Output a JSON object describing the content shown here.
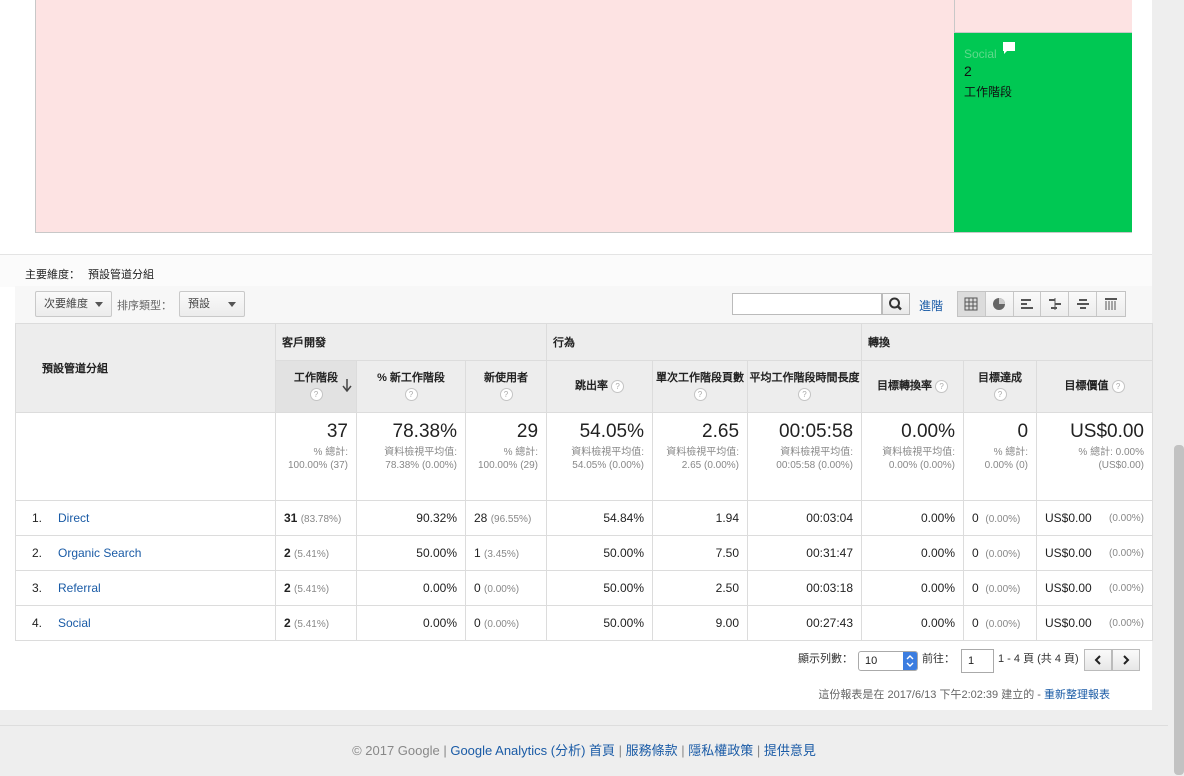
{
  "treemap": {
    "social_label": "Social",
    "social_value": "2",
    "social_unit": "工作階段"
  },
  "dimension": {
    "primary_label": "主要維度：",
    "primary_value": "預設管道分組"
  },
  "toolbar": {
    "secondary_dim": "次要維度",
    "sort_type_label": "排序類型：",
    "sort_type_value": "預設",
    "search_placeholder": "",
    "advanced": "進階"
  },
  "table": {
    "dim_header": "預設管道分組",
    "groups": [
      "客戶開發",
      "行為",
      "轉換"
    ],
    "columns": [
      "工作階段",
      "% 新工作階段",
      "新使用者",
      "跳出率",
      "單次工作階段頁數",
      "平均工作階段時間長度",
      "目標轉換率",
      "目標達成",
      "目標價值"
    ],
    "totals": [
      {
        "big": "37",
        "sm": "% 總計: 100.00% (37)"
      },
      {
        "big": "78.38%",
        "sm": "資料檢視平均值: 78.38% (0.00%)"
      },
      {
        "big": "29",
        "sm": "% 總計: 100.00% (29)"
      },
      {
        "big": "54.05%",
        "sm": "資料檢視平均值: 54.05% (0.00%)"
      },
      {
        "big": "2.65",
        "sm": "資料檢視平均值: 2.65 (0.00%)"
      },
      {
        "big": "00:05:58",
        "sm": "資料檢視平均值: 00:05:58 (0.00%)"
      },
      {
        "big": "0.00%",
        "sm": "資料檢視平均值: 0.00% (0.00%)"
      },
      {
        "big": "0",
        "sm": "% 總計: 0.00% (0)"
      },
      {
        "big": "US$0.00",
        "sm": "% 總計: 0.00% (US$0.00)"
      }
    ],
    "rows": [
      {
        "idx": "1.",
        "name": "Direct",
        "sessions": "31",
        "sessions_pct": "(83.78%)",
        "new_sessions": "90.32%",
        "new_users": "28",
        "new_users_pct": "(96.55%)",
        "bounce": "54.84%",
        "pages": "1.94",
        "duration": "00:03:04",
        "conv_rate": "0.00%",
        "completions": "0",
        "completions_pct": "(0.00%)",
        "value": "US$0.00",
        "value_pct": "(0.00%)"
      },
      {
        "idx": "2.",
        "name": "Organic Search",
        "sessions": "2",
        "sessions_pct": "(5.41%)",
        "new_sessions": "50.00%",
        "new_users": "1",
        "new_users_pct": "(3.45%)",
        "bounce": "50.00%",
        "pages": "7.50",
        "duration": "00:31:47",
        "conv_rate": "0.00%",
        "completions": "0",
        "completions_pct": "(0.00%)",
        "value": "US$0.00",
        "value_pct": "(0.00%)"
      },
      {
        "idx": "3.",
        "name": "Referral",
        "sessions": "2",
        "sessions_pct": "(5.41%)",
        "new_sessions": "0.00%",
        "new_users": "0",
        "new_users_pct": "(0.00%)",
        "bounce": "50.00%",
        "pages": "2.50",
        "duration": "00:03:18",
        "conv_rate": "0.00%",
        "completions": "0",
        "completions_pct": "(0.00%)",
        "value": "US$0.00",
        "value_pct": "(0.00%)"
      },
      {
        "idx": "4.",
        "name": "Social",
        "sessions": "2",
        "sessions_pct": "(5.41%)",
        "new_sessions": "0.00%",
        "new_users": "0",
        "new_users_pct": "(0.00%)",
        "bounce": "50.00%",
        "pages": "9.00",
        "duration": "00:27:43",
        "conv_rate": "0.00%",
        "completions": "0",
        "completions_pct": "(0.00%)",
        "value": "US$0.00",
        "value_pct": "(0.00%)"
      }
    ]
  },
  "pager": {
    "rows_label": "顯示列數：",
    "rows_value": "10",
    "goto_label": "前往：",
    "goto_value": "1",
    "range": "1 - 4 頁 (共 4 頁)"
  },
  "created": {
    "text": "這份報表是在 2017/6/13 下午2:02:39 建立的 - ",
    "refresh": "重新整理報表"
  },
  "footer": {
    "copyright": "© 2017 Google",
    "links": [
      "Google Analytics (分析) 首頁",
      "服務條款",
      "隱私權政策",
      "提供意見"
    ]
  }
}
